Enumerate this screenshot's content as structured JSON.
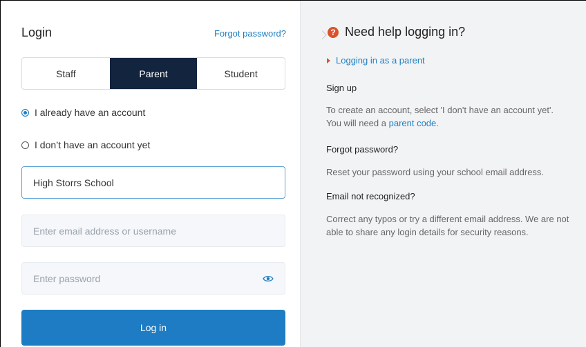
{
  "login": {
    "title": "Login",
    "forgot_password": "Forgot password?",
    "tabs": [
      "Staff",
      "Parent",
      "Student"
    ],
    "active_tab": "Parent",
    "options": {
      "have_account": "I already have an account",
      "no_account": "I don’t have an account yet"
    },
    "selected_option": "have_account",
    "school_value": "High Storrs School",
    "email_placeholder": "Enter email address or username",
    "password_placeholder": "Enter password",
    "button": "Log in"
  },
  "help": {
    "title": "Need help logging in?",
    "parent_link": "Logging in as a parent",
    "signup_heading": "Sign up",
    "signup_text_1": "To create an account, select 'I don't have an account yet'.",
    "signup_text_2": "You will need a",
    "signup_link": "parent code",
    "signup_text_3": ".",
    "forgot_heading": "Forgot password?",
    "forgot_text": "Reset your password using your school email address.",
    "email_heading": "Email not recognized?",
    "email_text": "Correct any typos or try a different email address. We are not able to share any login details for security reasons."
  },
  "colors": {
    "accent": "#1d7cc3",
    "tab_active": "#13243f",
    "help_icon": "#d9532c"
  }
}
